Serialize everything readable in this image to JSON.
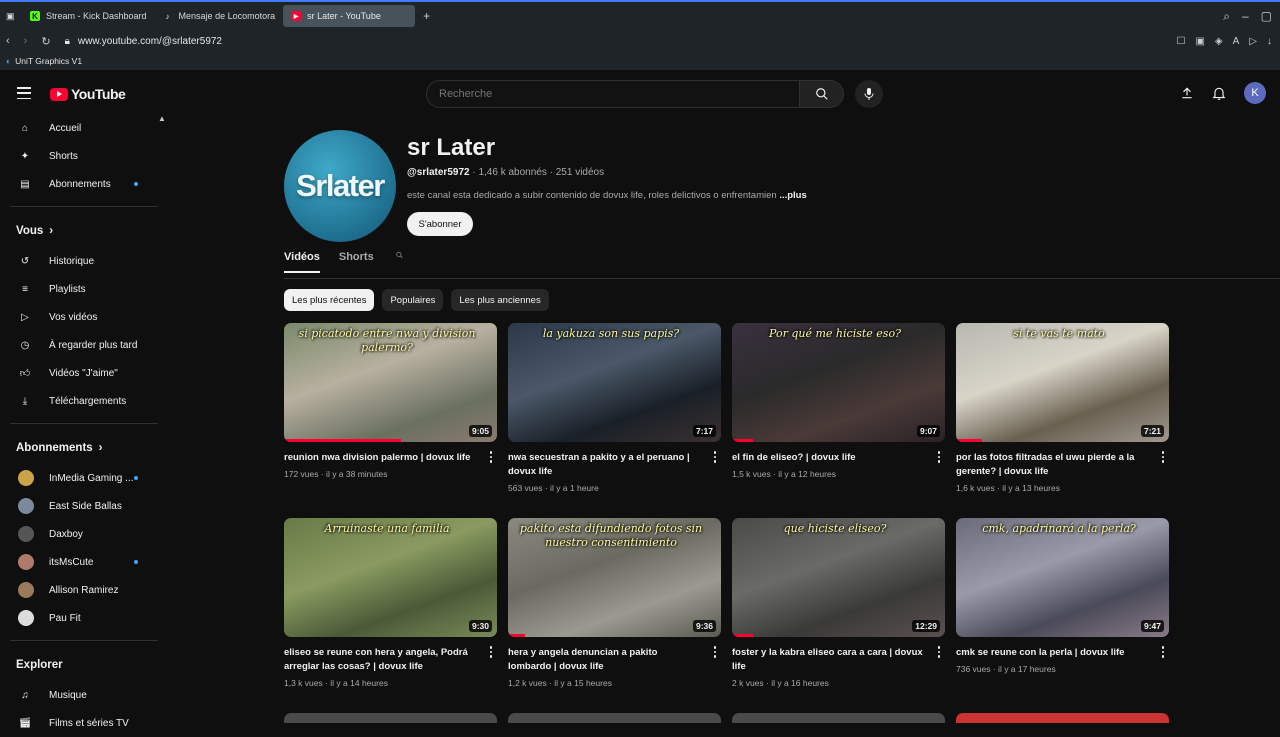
{
  "browser": {
    "tabs": [
      {
        "label": "Stream - Kick Dashboard",
        "color": "#53fc18",
        "glyph": "K"
      },
      {
        "label": "Mensaje de Locomotora",
        "color": "#f1f1f1",
        "glyph": "♪"
      },
      {
        "label": "sr Later - YouTube",
        "color": "#ff0033",
        "glyph": "▶"
      }
    ],
    "url": "www.youtube.com/@srlater5972",
    "bookmark": "UniT Graphics V1"
  },
  "header": {
    "logo_text": "YouTube",
    "search_placeholder": "Recherche",
    "avatar_letter": "K"
  },
  "sidebar": {
    "main": [
      {
        "label": "Accueil",
        "icon": "home-icon"
      },
      {
        "label": "Shorts",
        "icon": "shorts-icon"
      },
      {
        "label": "Abonnements",
        "icon": "subscriptions-icon",
        "dot": true
      }
    ],
    "you_title": "Vous",
    "you": [
      {
        "label": "Historique",
        "icon": "history-icon"
      },
      {
        "label": "Playlists",
        "icon": "playlists-icon"
      },
      {
        "label": "Vos vidéos",
        "icon": "your-videos-icon"
      },
      {
        "label": "À regarder plus tard",
        "icon": "watch-later-icon"
      },
      {
        "label": "Vidéos \"J'aime\"",
        "icon": "like-icon"
      },
      {
        "label": "Téléchargements",
        "icon": "download-icon"
      }
    ],
    "subs_title": "Abonnements",
    "subs": [
      {
        "label": "InMedia Gaming ...",
        "color": "#c9a24a",
        "dot": true
      },
      {
        "label": "East Side Ballas",
        "color": "#7a8a9a",
        "dot": false
      },
      {
        "label": "Daxboy",
        "color": "#555",
        "dot": false
      },
      {
        "label": "itsMsCute",
        "color": "#b07a6a",
        "dot": true
      },
      {
        "label": "Allison Ramirez",
        "color": "#9a7a5a",
        "dot": false
      },
      {
        "label": "Pau Fit",
        "color": "#ddd",
        "dot": false
      }
    ],
    "explore_title": "Explorer",
    "explore": [
      {
        "label": "Musique",
        "icon": "music-icon"
      },
      {
        "label": "Films et séries TV",
        "icon": "movies-icon"
      }
    ]
  },
  "channel": {
    "avatar_text": "Srlater",
    "name": "sr Later",
    "handle": "@srlater5972",
    "stats": " · 1,46 k abonnés · 251 vidéos",
    "description": "este canal esta dedicado a subir contenido de dovux life, roles delictivos o enfrentamien",
    "more": "...plus",
    "subscribe": "S'abonner",
    "tabs": [
      "Vidéos",
      "Shorts"
    ],
    "chips": [
      "Les plus récentes",
      "Populaires",
      "Les plus anciennes"
    ]
  },
  "videos": [
    {
      "title": "reunion nwa division palermo | dovux life",
      "meta": "172 vues · il y a 38 minutes",
      "duration": "9:05",
      "caption": "si picatodo entre nwa y division palermo?",
      "bg": "linear-gradient(160deg,#7a8a6a,#b8b0a0 40%,#6a7060 75%,#8a7a70)",
      "progress": 0.55
    },
    {
      "title": "nwa secuestran a pakito y a el peruano | dovux life",
      "meta": "563 vues · il y a 1 heure",
      "duration": "7:17",
      "caption": "la yakuza son sus papis?",
      "bg": "linear-gradient(160deg,#2a3848,#4a5868 40%,#1a2028 70%,#3a3030)",
      "progress": 0
    },
    {
      "title": "el fin de eliseo? | dovux life",
      "meta": "1,5 k vues · il y a 12 heures",
      "duration": "9:07",
      "caption": "Por qué me hiciste eso?",
      "bg": "linear-gradient(160deg,#3a3040,#2a2a2a 40%,#4a3a38 70%,#2a2226)",
      "progress": 0.1
    },
    {
      "title": "por las fotos filtradas el uwu pierde a la gerente? | dovux life",
      "meta": "1,6 k vues · il y a 13 heures",
      "duration": "7:21",
      "caption": "si te vas te mato",
      "bg": "linear-gradient(160deg,#b8b8b0,#d8d4c8 40%,#6a6050 70%,#a09890)",
      "progress": 0.12
    },
    {
      "title": "eliseo se reune con hera y angela, Podrá arreglar las cosas? | dovux life",
      "meta": "1,3 k vues · il y a 14 heures",
      "duration": "9:30",
      "caption": "Arruinaste una familia",
      "bg": "linear-gradient(160deg,#6a7a48,#8a9a60 40%,#4a5a38 70%,#7a8a58)",
      "progress": 0
    },
    {
      "title": "hera y angela denuncian a pakito lombardo | dovux life",
      "meta": "1,2 k vues · il y a 15 heures",
      "duration": "9:36",
      "caption": "pakito esta difundiendo fotos sin nuestro consentimiento",
      "bg": "linear-gradient(160deg,#8a8a80,#6a6a60 40%,#9a9a90 70%,#5a5a50)",
      "progress": 0.08
    },
    {
      "title": "foster y la kabra eliseo cara a cara | dovux life",
      "meta": "2 k vues · il y a 16 heures",
      "duration": "12:29",
      "caption": "que hiciste eliseo?",
      "bg": "linear-gradient(160deg,#4a4a48,#6a6a68 40%,#3a3a38 70%,#5a5050)",
      "progress": 0.1
    },
    {
      "title": "cmk se reune con la perla | dovux life",
      "meta": "736 vues · il y a 17 heures",
      "duration": "9:47",
      "caption": "cmk, apadrinará a la perla?",
      "bg": "linear-gradient(160deg,#6a6a78,#9a9aa8 40%,#4a4a58 70%,#8a7a88)",
      "progress": 0
    }
  ]
}
